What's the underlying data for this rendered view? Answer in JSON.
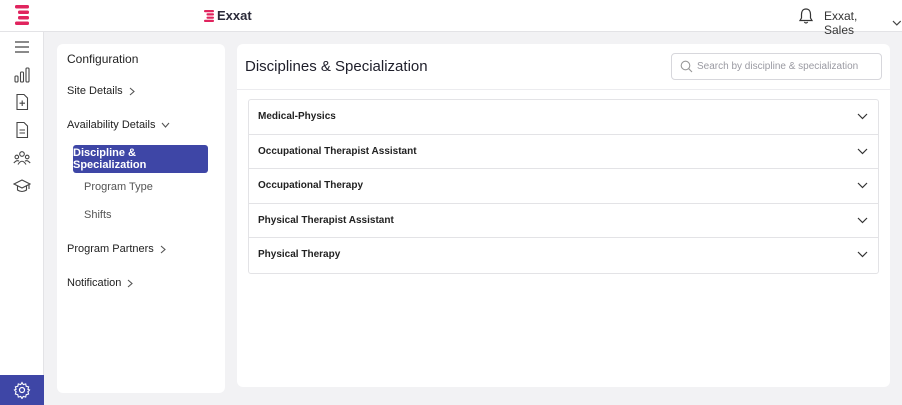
{
  "header": {
    "brand": "Exxat",
    "user_name": "Exxat, Sales"
  },
  "sidebar": {
    "icons": [
      "menu-icon",
      "analytics-icon",
      "add-document-icon",
      "document-icon",
      "people-icon",
      "graduation-cap-icon",
      "settings-icon"
    ]
  },
  "config": {
    "title": "Configuration",
    "items": [
      {
        "label": "Site Details",
        "state": "collapsed"
      },
      {
        "label": "Availability Details",
        "state": "expanded"
      },
      {
        "label": "Program Partners",
        "state": "collapsed"
      },
      {
        "label": "Notification",
        "state": "collapsed"
      }
    ],
    "sub_items": [
      {
        "label": "Discipline & Specialization",
        "active": true
      },
      {
        "label": "Program Type",
        "active": false
      },
      {
        "label": "Shifts",
        "active": false
      }
    ]
  },
  "main": {
    "title": "Disciplines & Specialization",
    "search_placeholder": "Search by discipline & specialization",
    "disciplines": [
      "Medical-Physics",
      "Occupational Therapist Assistant",
      "Occupational Therapy",
      "Physical Therapist Assistant",
      "Physical Therapy"
    ]
  },
  "colors": {
    "accent": "#3e46a6",
    "brand_pink": "#e0245e"
  }
}
